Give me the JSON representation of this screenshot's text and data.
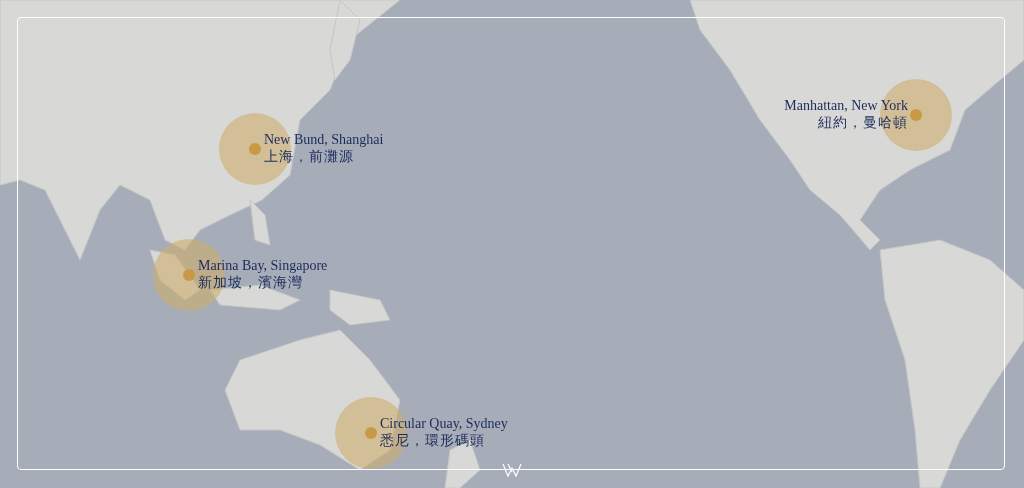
{
  "locations": [
    {
      "name": "New Bund, Shanghai",
      "local_name": "上海，前灘源"
    },
    {
      "name": "Marina Bay, Singapore",
      "local_name": "新加坡，濱海灣"
    },
    {
      "name": "Circular Quay, Sydney",
      "local_name": "悉尼，環形碼頭"
    },
    {
      "name": "Manhattan, New York",
      "local_name": "紐約，曼哈頓"
    }
  ]
}
